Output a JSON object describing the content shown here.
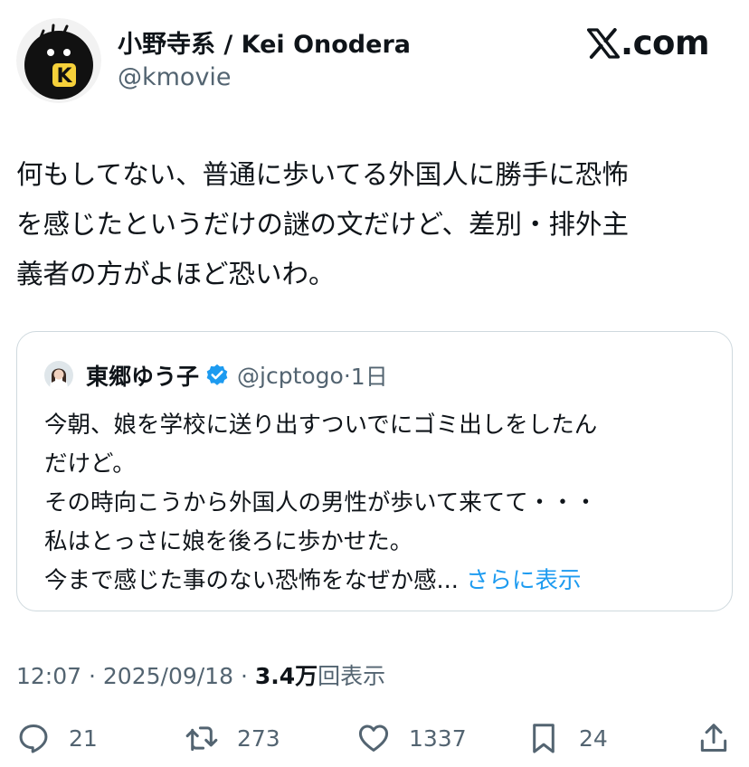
{
  "author": {
    "display_name": "小野寺系 / Kei Onodera",
    "handle": "@kmovie",
    "avatar_letter": "K"
  },
  "brand": {
    "text": ".com",
    "icon": "x-logo-icon"
  },
  "tweet": {
    "lines": [
      "何もしてない、普通に歩いてる外国人に勝手に恐怖",
      "を感じたというだけの謎の文だけど、差別・排外主",
      "義者の方がよほど恐いわ。"
    ]
  },
  "quoted": {
    "display_name": "東郷ゆう子",
    "verified_icon": "verified-badge-icon",
    "handle": "@jcptogo",
    "separator": "·",
    "time": "1日",
    "lines": [
      "今朝、娘を学校に送り出すついでにゴミ出しをしたん",
      "だけど。",
      "その時向こうから外国人の男性が歩いて来てて・・・",
      "私はとっさに娘を後ろに歩かせた。",
      "今まで感じた事のない恐怖をなぜか感..."
    ],
    "show_more": "さらに表示"
  },
  "meta": {
    "time": "12:07",
    "sep1": "·",
    "date": "2025/09/18",
    "sep2": "·",
    "views": "3.4万",
    "views_label": "回表示"
  },
  "actions": {
    "reply": {
      "icon": "reply-icon",
      "count": "21"
    },
    "retweet": {
      "icon": "retweet-icon",
      "count": "273"
    },
    "like": {
      "icon": "heart-icon",
      "count": "1337"
    },
    "bookmark": {
      "icon": "bookmark-icon",
      "count": "24"
    },
    "share": {
      "icon": "share-icon"
    }
  },
  "colors": {
    "text": "#0f1419",
    "secondary": "#536471",
    "accent": "#1d9bf0",
    "border": "#cfd9de"
  }
}
